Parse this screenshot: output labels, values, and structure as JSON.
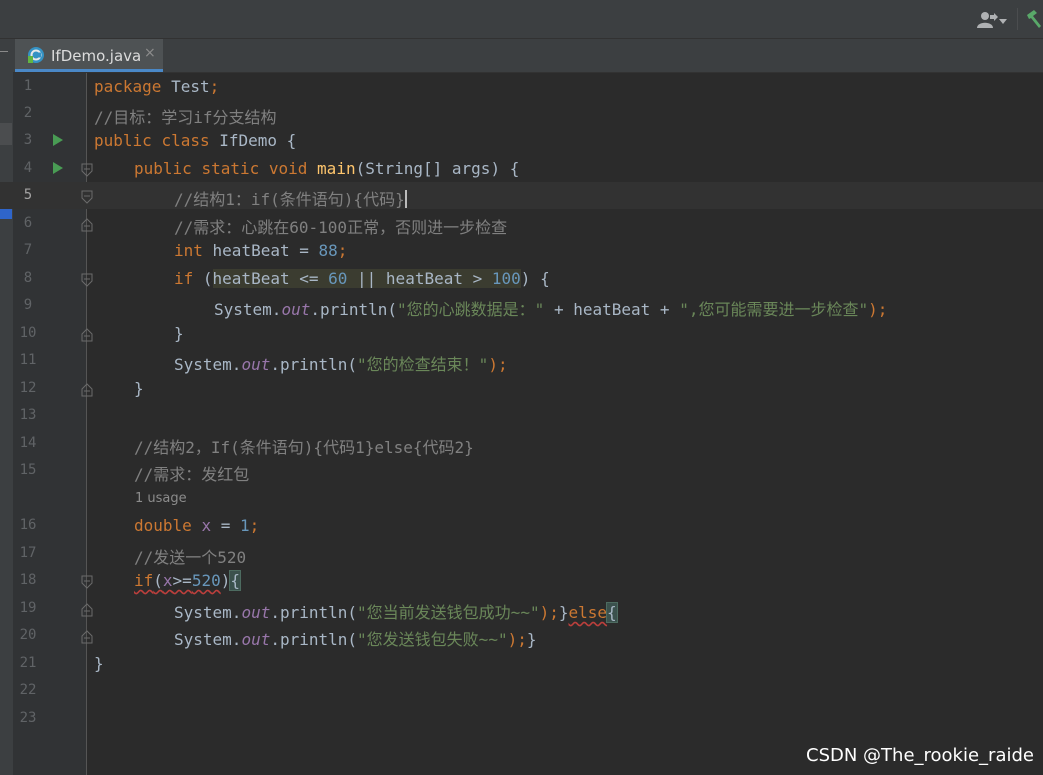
{
  "tab": {
    "filename": "IfDemo.java",
    "close": "×"
  },
  "watermark": "CSDN @The_rookie_raide",
  "icons": {
    "tab": "java-class-icon",
    "user": "user-account-icon",
    "build": "hammer-build-icon",
    "run": "run-triangle-icon",
    "fold": "fold-marker-icon"
  },
  "colors": {
    "keyword": "#cc7832",
    "comment": "#808080",
    "string": "#6a8759",
    "number": "#6897bb",
    "method": "#ffc66d",
    "field": "#9876aa",
    "tab_accent": "#4a88c7"
  },
  "editor": {
    "current_line": 5,
    "inlay_hint": "1 usage",
    "lines": [
      {
        "n": "1"
      },
      {
        "n": "2"
      },
      {
        "n": "3"
      },
      {
        "n": "4"
      },
      {
        "n": "5"
      },
      {
        "n": "6"
      },
      {
        "n": "7"
      },
      {
        "n": "8"
      },
      {
        "n": "9"
      },
      {
        "n": "10"
      },
      {
        "n": "11"
      },
      {
        "n": "12"
      },
      {
        "n": "13"
      },
      {
        "n": "14"
      },
      {
        "n": "15"
      },
      {
        "n": "16"
      },
      {
        "n": "17"
      },
      {
        "n": "18"
      },
      {
        "n": "19"
      },
      {
        "n": "20"
      },
      {
        "n": "21"
      },
      {
        "n": "22"
      },
      {
        "n": "23"
      }
    ],
    "tokens": {
      "l1": [
        "package",
        " Test",
        ";"
      ],
      "l2": [
        "//目标：学习if分支结构"
      ],
      "l3": [
        "public",
        " ",
        "class",
        " IfDemo {"
      ],
      "l4": [
        "public",
        " ",
        "static",
        " ",
        "void",
        " ",
        "main",
        "(String[] args) {"
      ],
      "l5": [
        "//结构1：if(条件语句){代码}"
      ],
      "l6": [
        "//需求：心跳在60-100正常，否则进一步检查"
      ],
      "l7": [
        "int",
        " heatBeat = ",
        "88",
        ";"
      ],
      "l8": [
        "if",
        " (",
        "heatBeat <= ",
        "60",
        " || heatBeat > ",
        "100",
        ")",
        " {"
      ],
      "l9": [
        "System.",
        "out",
        ".println(",
        "\"您的心跳数据是：\"",
        " + heatBeat + ",
        "\",您可能需要进一步检查\"",
        ");"
      ],
      "l10": [
        "}"
      ],
      "l11": [
        "System.",
        "out",
        ".println(",
        "\"您的检查结束！\"",
        ");"
      ],
      "l12": [
        "}"
      ],
      "l14": [
        "//结构2，If(条件语句){代码1}else{代码2}"
      ],
      "l15": [
        "//需求：发红包"
      ],
      "l16": [
        "double",
        " ",
        "x",
        " = ",
        "1",
        ";"
      ],
      "l17": [
        "//发送一个520"
      ],
      "l18": [
        "if",
        "(",
        "x",
        ">=",
        "520",
        ")",
        "{"
      ],
      "l19": [
        "System.",
        "out",
        ".println(",
        "\"您当前发送钱包成功~~\"",
        ");",
        "}",
        "else",
        "{"
      ],
      "l20": [
        "System.",
        "out",
        ".println(",
        "\"您发送钱包失败~~\"",
        ");",
        "}"
      ],
      "l21": [
        "}"
      ]
    }
  }
}
